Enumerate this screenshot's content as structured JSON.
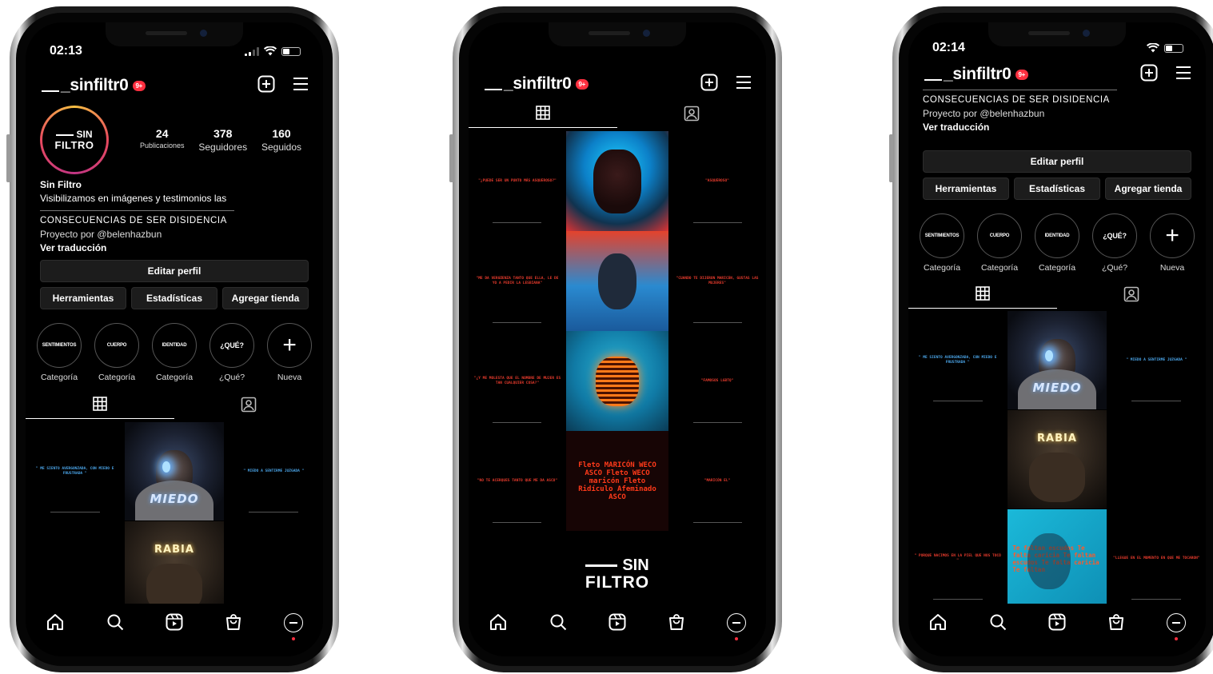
{
  "phones": {
    "left": {
      "status": {
        "time": "02:13"
      },
      "header": {
        "username": "_sinfiltr0",
        "badge": "9+"
      },
      "profile": {
        "avatar": {
          "line1": "SIN",
          "line2": "FILTRO"
        },
        "stats": [
          {
            "value": "24",
            "label": "Publicaciones"
          },
          {
            "value": "378",
            "label": "Seguidores"
          },
          {
            "value": "160",
            "label": "Seguidos"
          }
        ],
        "name": "Sin Filtro",
        "bio_line": "Visibilizamos en imágenes y testimonios las",
        "bio_caps": "CONSECUENCIAS DE SER DISIDENCIA",
        "credit": "Proyecto por @belenhazbun",
        "translate": "Ver traducción"
      },
      "buttons": {
        "edit": "Editar perfil",
        "tools": "Herramientas",
        "stats": "Estadísticas",
        "shop": "Agregar tienda"
      },
      "highlights": [
        {
          "cover": "SENTIMIENTOS",
          "label": "Categoría"
        },
        {
          "cover": "CUERPO",
          "label": "Categoría"
        },
        {
          "cover": "IDENTIDAD",
          "label": "Categoría"
        },
        {
          "cover": "¿QUÉ?",
          "label": "¿Qué?"
        },
        {
          "cover": "+",
          "label": "Nueva"
        }
      ],
      "grid": {
        "q1": "\" ME SIENTO AVERGONZADA, CON MIEDO E FRUSTRADA \"",
        "q2": "\" MIEDO A SENTIRME JUZGADA \"",
        "word1": "MIEDO",
        "word2": "RABIA"
      }
    },
    "center": {
      "header": {
        "username": "_sinfiltr0",
        "badge": "9+"
      },
      "feed": {
        "left_quotes": [
          "\"¿PUEDE SER UN PUNTO MÁS ASQUEROSO?\"",
          "\"ME DA VERGÜENZA TANTO QUE ELLA, LE DE YO A PEDIR LA LESBIANA\"",
          "\"¿Y ME MOLESTA QUE EL NOMBRE DE MUJER ES TAN CUALQUIER COSA?\"",
          "\"NO TE ACERQUES TANTO QUE ME DA ASCO\""
        ],
        "right_quotes": [
          "\"ASQUEROSO\"",
          "\"CUANDO TE DIJERON MARICÓN, GUSTAS LAS MUJERES\"",
          "\"FAMOSOS LGBTQ\"",
          "\"MARICÓN EL\""
        ],
        "art_words": "Fleto MARICÓN WECO ASCO Fleto WECO maricón Fleto Ridículo Afeminado ASCO"
      },
      "logo": {
        "line1": "SIN",
        "line2": "FILTRO"
      }
    },
    "right": {
      "status": {
        "time": "02:14"
      },
      "header": {
        "username": "_sinfiltr0",
        "badge": "9+"
      },
      "profile": {
        "bio_caps": "CONSECUENCIAS DE SER DISIDENCIA",
        "credit": "Proyecto por @belenhazbun",
        "translate": "Ver traducción"
      },
      "buttons": {
        "edit": "Editar perfil",
        "tools": "Herramientas",
        "stats": "Estadísticas",
        "shop": "Agregar tienda"
      },
      "highlights": [
        {
          "cover": "SENTIMIENTOS",
          "label": "Categoría"
        },
        {
          "cover": "CUERPO",
          "label": "Categoría"
        },
        {
          "cover": "IDENTIDAD",
          "label": "Categoría"
        },
        {
          "cover": "¿QUÉ?",
          "label": "¿Qué?"
        },
        {
          "cover": "+",
          "label": "Nueva"
        }
      ],
      "grid": {
        "q1": "\" ME SIENTO AVERGONZADA, CON MIEDO E FRUSTRADA \"",
        "q2": "\" MIEDO A SENTIRME JUZGADA \"",
        "q3": "\" PORQUE NACIMOS EN LA PIEL QUE NOS TOCÓ \"",
        "q4": "\"LLEGUE EN EL MOMENTO EN QUE ME TOCARON\"",
        "word1": "MIEDO",
        "word2": "RABIA",
        "blue_words": "Te faltan escudos Te falta caricia Te faltan escudos Te falta caricia Te faltan"
      }
    }
  },
  "colors": {
    "badge": "#ff3040",
    "ring": "#e84a5f",
    "quote_blue": "#4aa3e6",
    "quote_red": "#e43a2c"
  },
  "icons": [
    "new-post-icon",
    "menu-icon",
    "grid-icon",
    "tagged-icon",
    "home-icon",
    "search-icon",
    "reels-icon",
    "shop-icon",
    "profile-icon"
  ]
}
